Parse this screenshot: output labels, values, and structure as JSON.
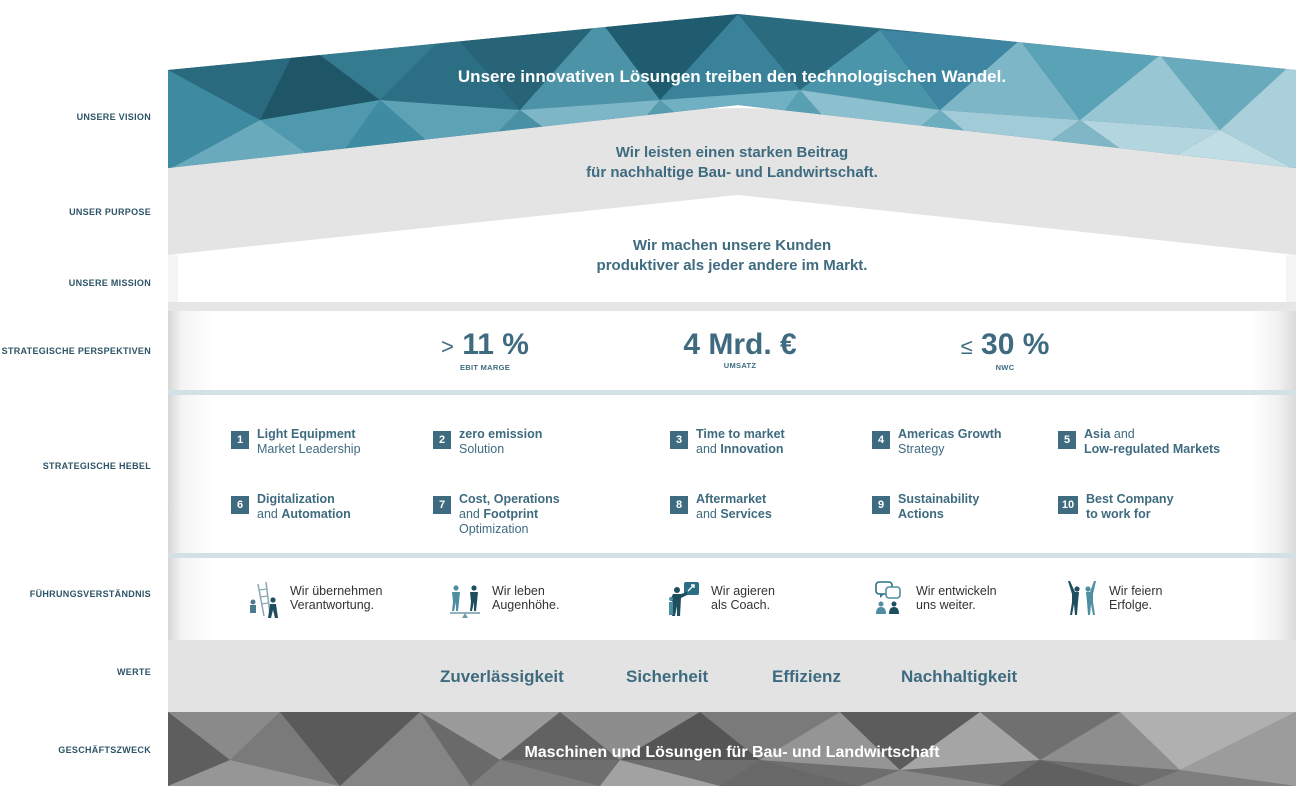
{
  "labels": {
    "vision": "UNSERE VISION",
    "purpose": "UNSER PURPOSE",
    "mission": "UNSERE MISSION",
    "perspectives": "STRATEGISCHE PERSPEKTIVEN",
    "levers": "STRATEGISCHE HEBEL",
    "leadership": "FÜHRUNGSVERSTÄNDNIS",
    "values": "WERTE",
    "business": "GESCHÄFTSZWECK"
  },
  "vision": "Unsere innovativen Lösungen treiben den technologischen Wandel.",
  "purpose": {
    "line1": "Wir leisten einen starken Beitrag",
    "line2": "für nachhaltige Bau- und Landwirtschaft."
  },
  "mission": {
    "line1": "Wir machen unsere Kunden",
    "line2": "produktiver als jeder andere im Markt."
  },
  "kpis": [
    {
      "symbol": ">",
      "value": "11 %",
      "label": "EBIT MARGE"
    },
    {
      "symbol": "",
      "value": "4 Mrd. €",
      "label": "UMSATZ"
    },
    {
      "symbol": "≤",
      "value": "30 %",
      "label": "NWC"
    }
  ],
  "levers": [
    {
      "num": "1",
      "a": "Light Equipment",
      "b": "Market Leadership"
    },
    {
      "num": "2",
      "a": "zero emission",
      "b": "Solution"
    },
    {
      "num": "3",
      "a": "Time to market",
      "b1": "and ",
      "b2": "Innovation"
    },
    {
      "num": "4",
      "a": "Americas Growth",
      "b": "Strategy"
    },
    {
      "num": "5",
      "a1": "Asia",
      "a2": " and",
      "b": "Low-regulated Markets"
    },
    {
      "num": "6",
      "a": "Digitalization",
      "b1": "and ",
      "b2": "Automation"
    },
    {
      "num": "7",
      "a": "Cost, Operations",
      "b1": "and ",
      "b2": "Footprint",
      "c": "Optimization"
    },
    {
      "num": "8",
      "a": "Aftermarket",
      "b1": "and ",
      "b2": "Services"
    },
    {
      "num": "9",
      "a": "Sustainability",
      "b": "Actions"
    },
    {
      "num": "10",
      "a": "Best Company",
      "b": "to work for"
    }
  ],
  "leadership": [
    {
      "icon": "ladder-people-icon",
      "l1": "Wir übernehmen",
      "l2": "Verantwortung."
    },
    {
      "icon": "balance-people-icon",
      "l1": "Wir leben",
      "l2": "Augenhöhe."
    },
    {
      "icon": "coach-icon",
      "l1": "Wir agieren",
      "l2": "als Coach."
    },
    {
      "icon": "chat-people-icon",
      "l1": "Wir entwickeln",
      "l2": "uns weiter."
    },
    {
      "icon": "celebrate-icon",
      "l1": "Wir feiern",
      "l2": "Erfolge."
    }
  ],
  "values": [
    "Zuverlässigkeit",
    "Sicherheit",
    "Effizienz",
    "Nachhaltigkeit"
  ],
  "business": "Maschinen und Lösungen für Bau- und Landwirtschaft",
  "colors": {
    "teal_dark": "#1f5a6e",
    "teal_mid": "#3e8299",
    "teal_light": "#7fb3c4",
    "text_teal": "#3e6b7f",
    "grey_band": "#e3e3e3",
    "dark_grey": "#6a6a6a"
  }
}
